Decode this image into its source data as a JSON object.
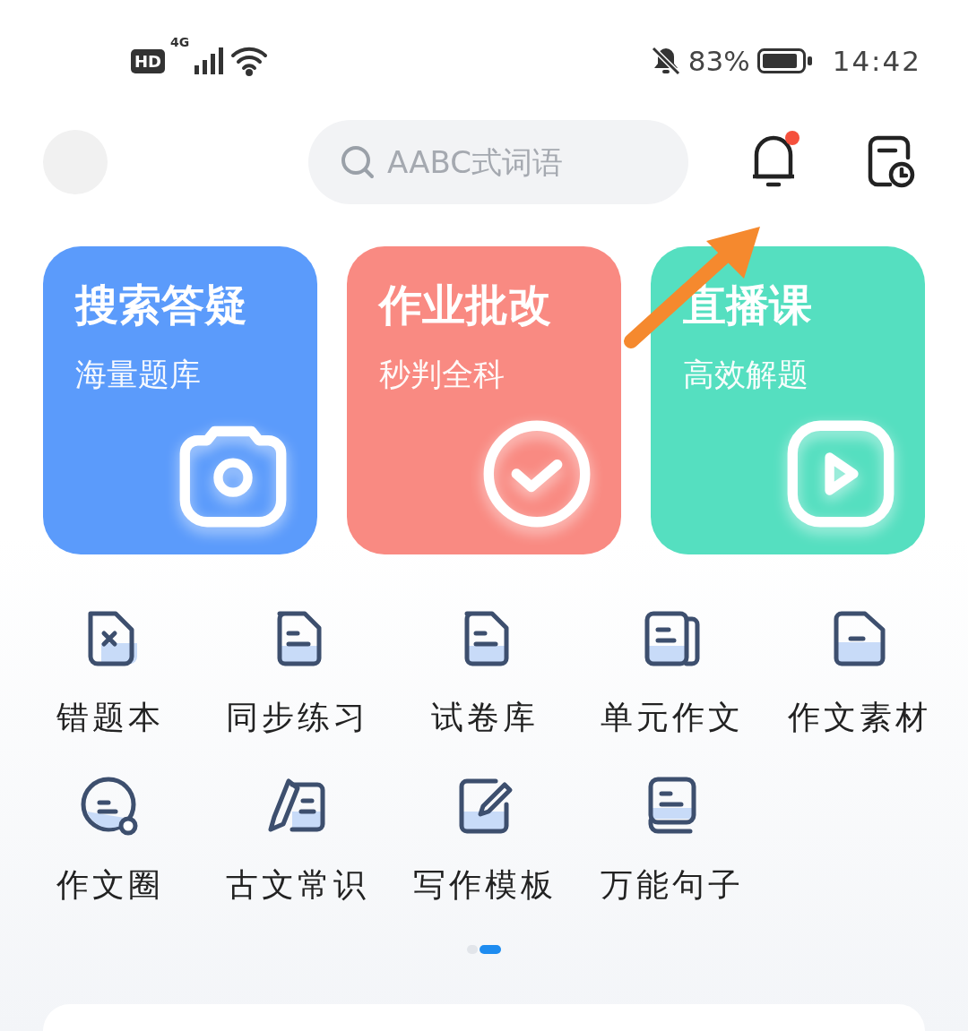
{
  "status_bar": {
    "hd": "HD",
    "network": "4G",
    "battery_text": "83%",
    "muted": true,
    "time": "14:42"
  },
  "header": {
    "search": {
      "placeholder": "AABC式词语"
    },
    "notification_unread": true
  },
  "cards": [
    {
      "title": "搜索答疑",
      "subtitle": "海量题库",
      "color": "#5b9bfb",
      "kind": "camera"
    },
    {
      "title": "作业批改",
      "subtitle": "秒判全科",
      "color": "#f98a82",
      "kind": "check"
    },
    {
      "title": "直播课",
      "subtitle": "高效解题",
      "color": "#55dfc0",
      "kind": "play"
    }
  ],
  "tools": [
    {
      "label": "错题本",
      "kind": "error"
    },
    {
      "label": "同步练习",
      "kind": "doc"
    },
    {
      "label": "试卷库",
      "kind": "doc"
    },
    {
      "label": "单元作文",
      "kind": "docs"
    },
    {
      "label": "作文素材",
      "kind": "folder"
    },
    {
      "label": "作文圈",
      "kind": "chat"
    },
    {
      "label": "古文常识",
      "kind": "brush"
    },
    {
      "label": "写作模板",
      "kind": "edit"
    },
    {
      "label": "万能句子",
      "kind": "book"
    }
  ],
  "pager": [
    {
      "selected": false
    },
    {
      "selected": true
    }
  ]
}
